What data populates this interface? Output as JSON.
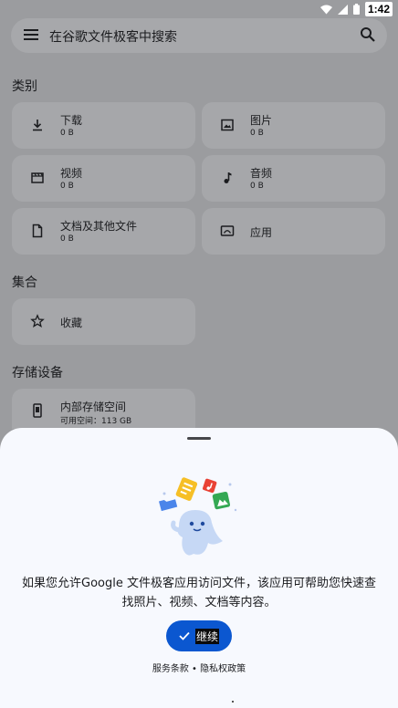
{
  "status": {
    "time": "1:42",
    "icons": [
      "wifi-icon",
      "signal-icon",
      "battery-icon"
    ]
  },
  "search": {
    "placeholder": "在谷歌文件极客中搜索"
  },
  "sections": {
    "categories": "类别",
    "collections": "集合",
    "storage": "存储设备"
  },
  "categories": [
    {
      "title": "下载",
      "size": "0 B",
      "icon": "download-icon"
    },
    {
      "title": "图片",
      "size": "0 B",
      "icon": "image-icon"
    },
    {
      "title": "视频",
      "size": "0 B",
      "icon": "video-icon"
    },
    {
      "title": "音频",
      "size": "0 B",
      "icon": "audio-icon"
    },
    {
      "title": "文档及其他文件",
      "size": "0 B",
      "icon": "document-icon"
    },
    {
      "title": "应用",
      "size": "",
      "icon": "apps-icon"
    }
  ],
  "collections": [
    {
      "title": "收藏",
      "icon": "star-icon"
    }
  ],
  "storage": [
    {
      "title": "内部存储空间",
      "available": "可用空间：113 GB",
      "icon": "phone-icon"
    }
  ],
  "sheet": {
    "message": "如果您允许Google 文件极客应用访问文件，该应用可帮助您快速查找照片、视频、文档等内容。",
    "continue_label": "继续",
    "terms": "服务条款",
    "separator": "•",
    "privacy": "隐私权政策"
  },
  "colors": {
    "accent": "#0b57d0",
    "scrim": "#9b9c9f",
    "sheet": "#f7f9fe"
  }
}
